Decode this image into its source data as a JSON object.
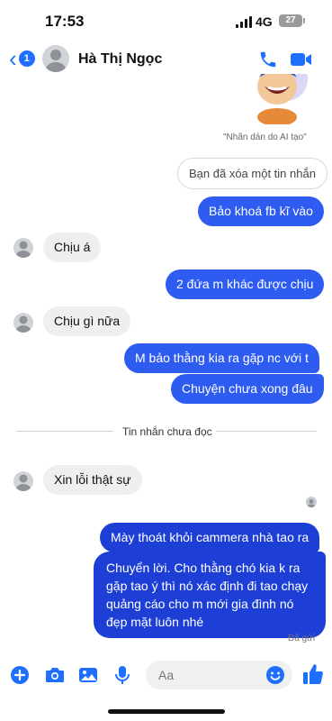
{
  "status": {
    "time": "17:53",
    "network": "4G",
    "battery": "27"
  },
  "header": {
    "back_badge": "1",
    "contact_name": "Hà Thị Ngọc"
  },
  "sticker": {
    "caption": "\"Nhãn dán do AI tạo\""
  },
  "messages": [
    {
      "side": "out",
      "style": "ghost",
      "text": "Bạn đã xóa một tin nhắn"
    },
    {
      "side": "out",
      "text": "Bảo khoá fb kĩ vào"
    },
    {
      "side": "in",
      "text": "Chịu á"
    },
    {
      "side": "out",
      "text": "2 đứa m khác được chịu"
    },
    {
      "side": "in",
      "text": "Chịu gì nữa"
    },
    {
      "side": "out",
      "text": "M bảo thằng kia ra gặp nc với t"
    },
    {
      "side": "out",
      "text": "Chuyện chưa xong đâu"
    },
    {
      "side": "in",
      "text": "Xin lỗi thật sự"
    },
    {
      "side": "out",
      "text": "Mày thoát khỏi cammera nhà tao ra"
    },
    {
      "side": "out",
      "lines": [
        "Chuyển lời. Cho thằng chó kia k ra",
        "gặp tao ý thì nó xác định đi tao chạy",
        "quảng cáo cho m mới gia đình nó",
        "đẹp mặt luôn nhé"
      ]
    }
  ],
  "unread_divider": "Tin nhắn chưa đọc",
  "delivery_status": "Đã gửi",
  "composer": {
    "placeholder": "Aa"
  },
  "colors": {
    "accent": "#1f6fff",
    "outgoing_bubble": "#2e5cf0",
    "incoming_bubble": "#efefef"
  }
}
